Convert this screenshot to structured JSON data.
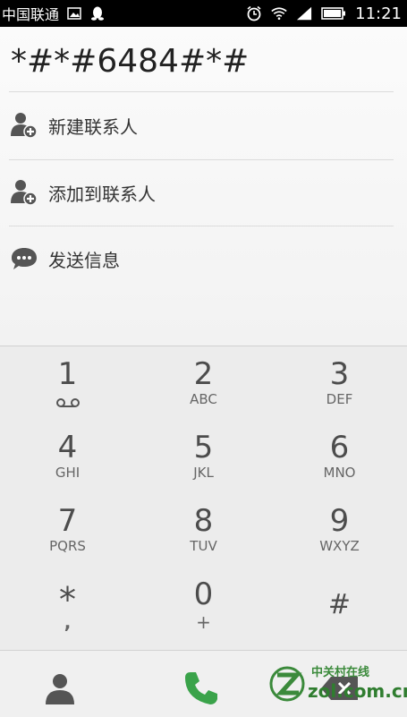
{
  "status_bar": {
    "carrier": "中国联通",
    "time": "11:21",
    "icons": [
      "image-icon",
      "qq-icon",
      "alarm-icon",
      "wifi-icon",
      "signal-icon",
      "battery-icon"
    ]
  },
  "dialer": {
    "number": "*#*#6484#*#"
  },
  "actions": [
    {
      "label": "新建联系人",
      "icon": "add-contact-icon"
    },
    {
      "label": "添加到联系人",
      "icon": "add-to-contact-icon"
    },
    {
      "label": "发送信息",
      "icon": "message-icon"
    }
  ],
  "keypad": [
    {
      "digit": "1",
      "letters": ""
    },
    {
      "digit": "2",
      "letters": "ABC"
    },
    {
      "digit": "3",
      "letters": "DEF"
    },
    {
      "digit": "4",
      "letters": "GHI"
    },
    {
      "digit": "5",
      "letters": "JKL"
    },
    {
      "digit": "6",
      "letters": "MNO"
    },
    {
      "digit": "7",
      "letters": "PQRS"
    },
    {
      "digit": "8",
      "letters": "TUV"
    },
    {
      "digit": "9",
      "letters": "WXYZ"
    },
    {
      "digit": "*",
      "letters": ","
    },
    {
      "digit": "0",
      "letters": "+"
    },
    {
      "digit": "#",
      "letters": ""
    }
  ],
  "bottom_bar": {
    "contacts_icon": "person-icon",
    "call_icon": "phone-icon",
    "delete_icon": "backspace-icon"
  },
  "watermark": {
    "title": "中关村在线",
    "url": "zol.com.cn"
  },
  "colors": {
    "call_green": "#3aa34a",
    "text_dark": "#333333",
    "key_text": "#4c4c4c"
  }
}
